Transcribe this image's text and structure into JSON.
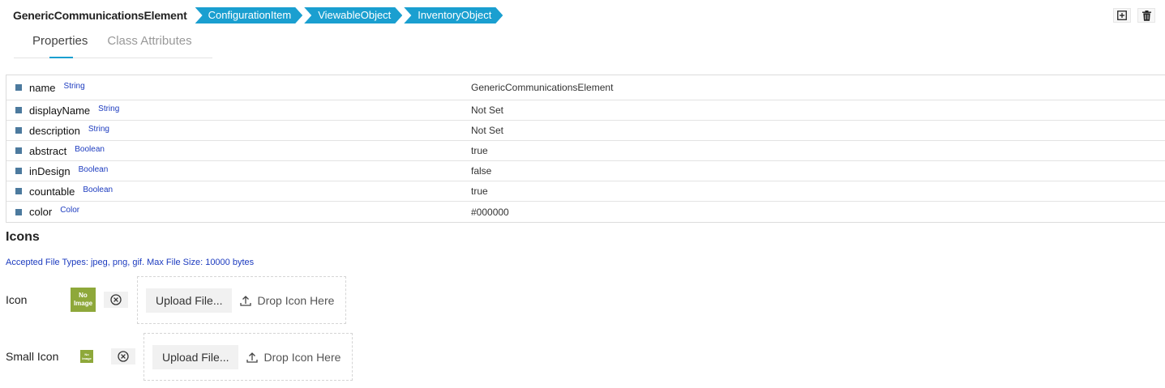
{
  "header": {
    "class_name": "GenericCommunicationsElement",
    "breadcrumbs": [
      "ConfigurationItem",
      "ViewableObject",
      "InventoryObject"
    ]
  },
  "tabs": [
    {
      "label": "Properties",
      "active": true
    },
    {
      "label": "Class Attributes",
      "active": false
    }
  ],
  "properties": [
    {
      "name": "name",
      "type": "String",
      "value": "GenericCommunicationsElement"
    },
    {
      "name": "displayName",
      "type": "String",
      "value": "Not Set"
    },
    {
      "name": "description",
      "type": "String",
      "value": "Not Set"
    },
    {
      "name": "abstract",
      "type": "Boolean",
      "value": "true"
    },
    {
      "name": "inDesign",
      "type": "Boolean",
      "value": "false"
    },
    {
      "name": "countable",
      "type": "Boolean",
      "value": "true"
    },
    {
      "name": "color",
      "type": "Color",
      "value": "#000000"
    }
  ],
  "icons": {
    "title": "Icons",
    "accepted": "Accepted File Types: jpeg, png, gif. Max File Size: 10000 bytes",
    "rows": [
      {
        "label": "Icon",
        "placeholder": [
          "No",
          "Image"
        ],
        "upload_label": "Upload File...",
        "drop_label": "Drop Icon Here"
      },
      {
        "label": "Small Icon",
        "placeholder": [
          "No",
          "Image"
        ],
        "upload_label": "Upload File...",
        "drop_label": "Drop Icon Here"
      }
    ]
  },
  "colors": {
    "accent": "#1a9fd0",
    "type_label": "#1c3bbf",
    "bullet": "#4c7a9e",
    "no_image": "#8ea83a"
  },
  "icon_names": {
    "add": "add-box-icon",
    "delete": "trash-icon",
    "clear": "clear-circle-icon",
    "upload": "upload-icon"
  }
}
